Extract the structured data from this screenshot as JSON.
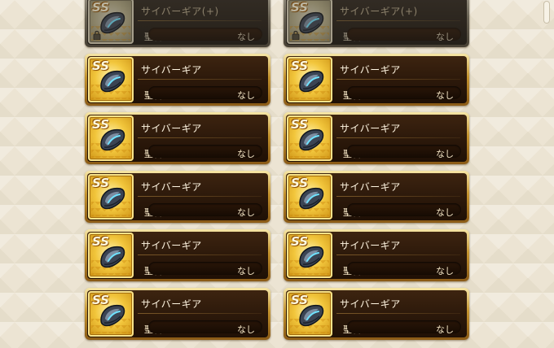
{
  "colors": {
    "frame_gold": "#c5942f",
    "panel_dark": "#2b180a",
    "icon_gold": "#f2c63c",
    "text_light": "#fff5e1",
    "background": "#ece4d3"
  },
  "cards": [
    {
      "rank": "SS",
      "name": "サイバーギア(+)",
      "stone_label": "聖石",
      "value": "なし",
      "locked": true,
      "icon": "cyber-gear-icon"
    },
    {
      "rank": "SS",
      "name": "サイバーギア(+)",
      "stone_label": "聖石",
      "value": "なし",
      "locked": true,
      "icon": "cyber-gear-icon"
    },
    {
      "rank": "SS",
      "name": "サイバーギア",
      "stone_label": "聖石",
      "value": "なし",
      "locked": false,
      "icon": "cyber-gear-icon"
    },
    {
      "rank": "SS",
      "name": "サイバーギア",
      "stone_label": "聖石",
      "value": "なし",
      "locked": false,
      "icon": "cyber-gear-icon"
    },
    {
      "rank": "SS",
      "name": "サイバーギア",
      "stone_label": "聖石",
      "value": "なし",
      "locked": false,
      "icon": "cyber-gear-icon"
    },
    {
      "rank": "SS",
      "name": "サイバーギア",
      "stone_label": "聖石",
      "value": "なし",
      "locked": false,
      "icon": "cyber-gear-icon"
    },
    {
      "rank": "SS",
      "name": "サイバーギア",
      "stone_label": "聖石",
      "value": "なし",
      "locked": false,
      "icon": "cyber-gear-icon"
    },
    {
      "rank": "SS",
      "name": "サイバーギア",
      "stone_label": "聖石",
      "value": "なし",
      "locked": false,
      "icon": "cyber-gear-icon"
    },
    {
      "rank": "SS",
      "name": "サイバーギア",
      "stone_label": "聖石",
      "value": "なし",
      "locked": false,
      "icon": "cyber-gear-icon"
    },
    {
      "rank": "SS",
      "name": "サイバーギア",
      "stone_label": "聖石",
      "value": "なし",
      "locked": false,
      "icon": "cyber-gear-icon"
    },
    {
      "rank": "SS",
      "name": "サイバーギア",
      "stone_label": "聖石",
      "value": "なし",
      "locked": false,
      "icon": "cyber-gear-icon"
    },
    {
      "rank": "SS",
      "name": "サイバーギア",
      "stone_label": "聖石",
      "value": "なし",
      "locked": false,
      "icon": "cyber-gear-icon"
    }
  ]
}
